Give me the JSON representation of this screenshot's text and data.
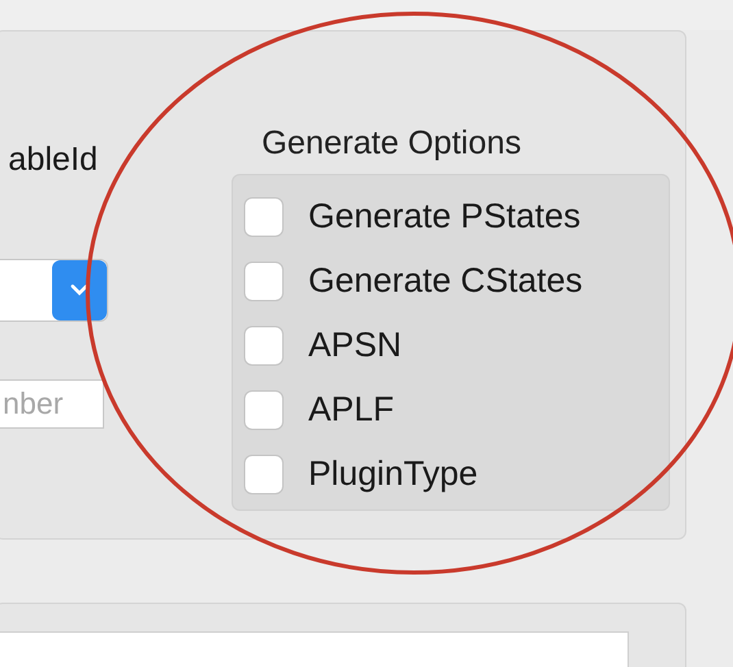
{
  "form": {
    "label": "ableId",
    "number_field": {
      "placeholder": "nber"
    }
  },
  "generate_options": {
    "title": "Generate Options",
    "options": [
      {
        "label": "Generate PStates",
        "checked": false
      },
      {
        "label": "Generate CStates",
        "checked": false
      },
      {
        "label": "APSN",
        "checked": false
      },
      {
        "label": "APLF",
        "checked": false
      },
      {
        "label": "PluginType",
        "checked": false
      }
    ]
  }
}
